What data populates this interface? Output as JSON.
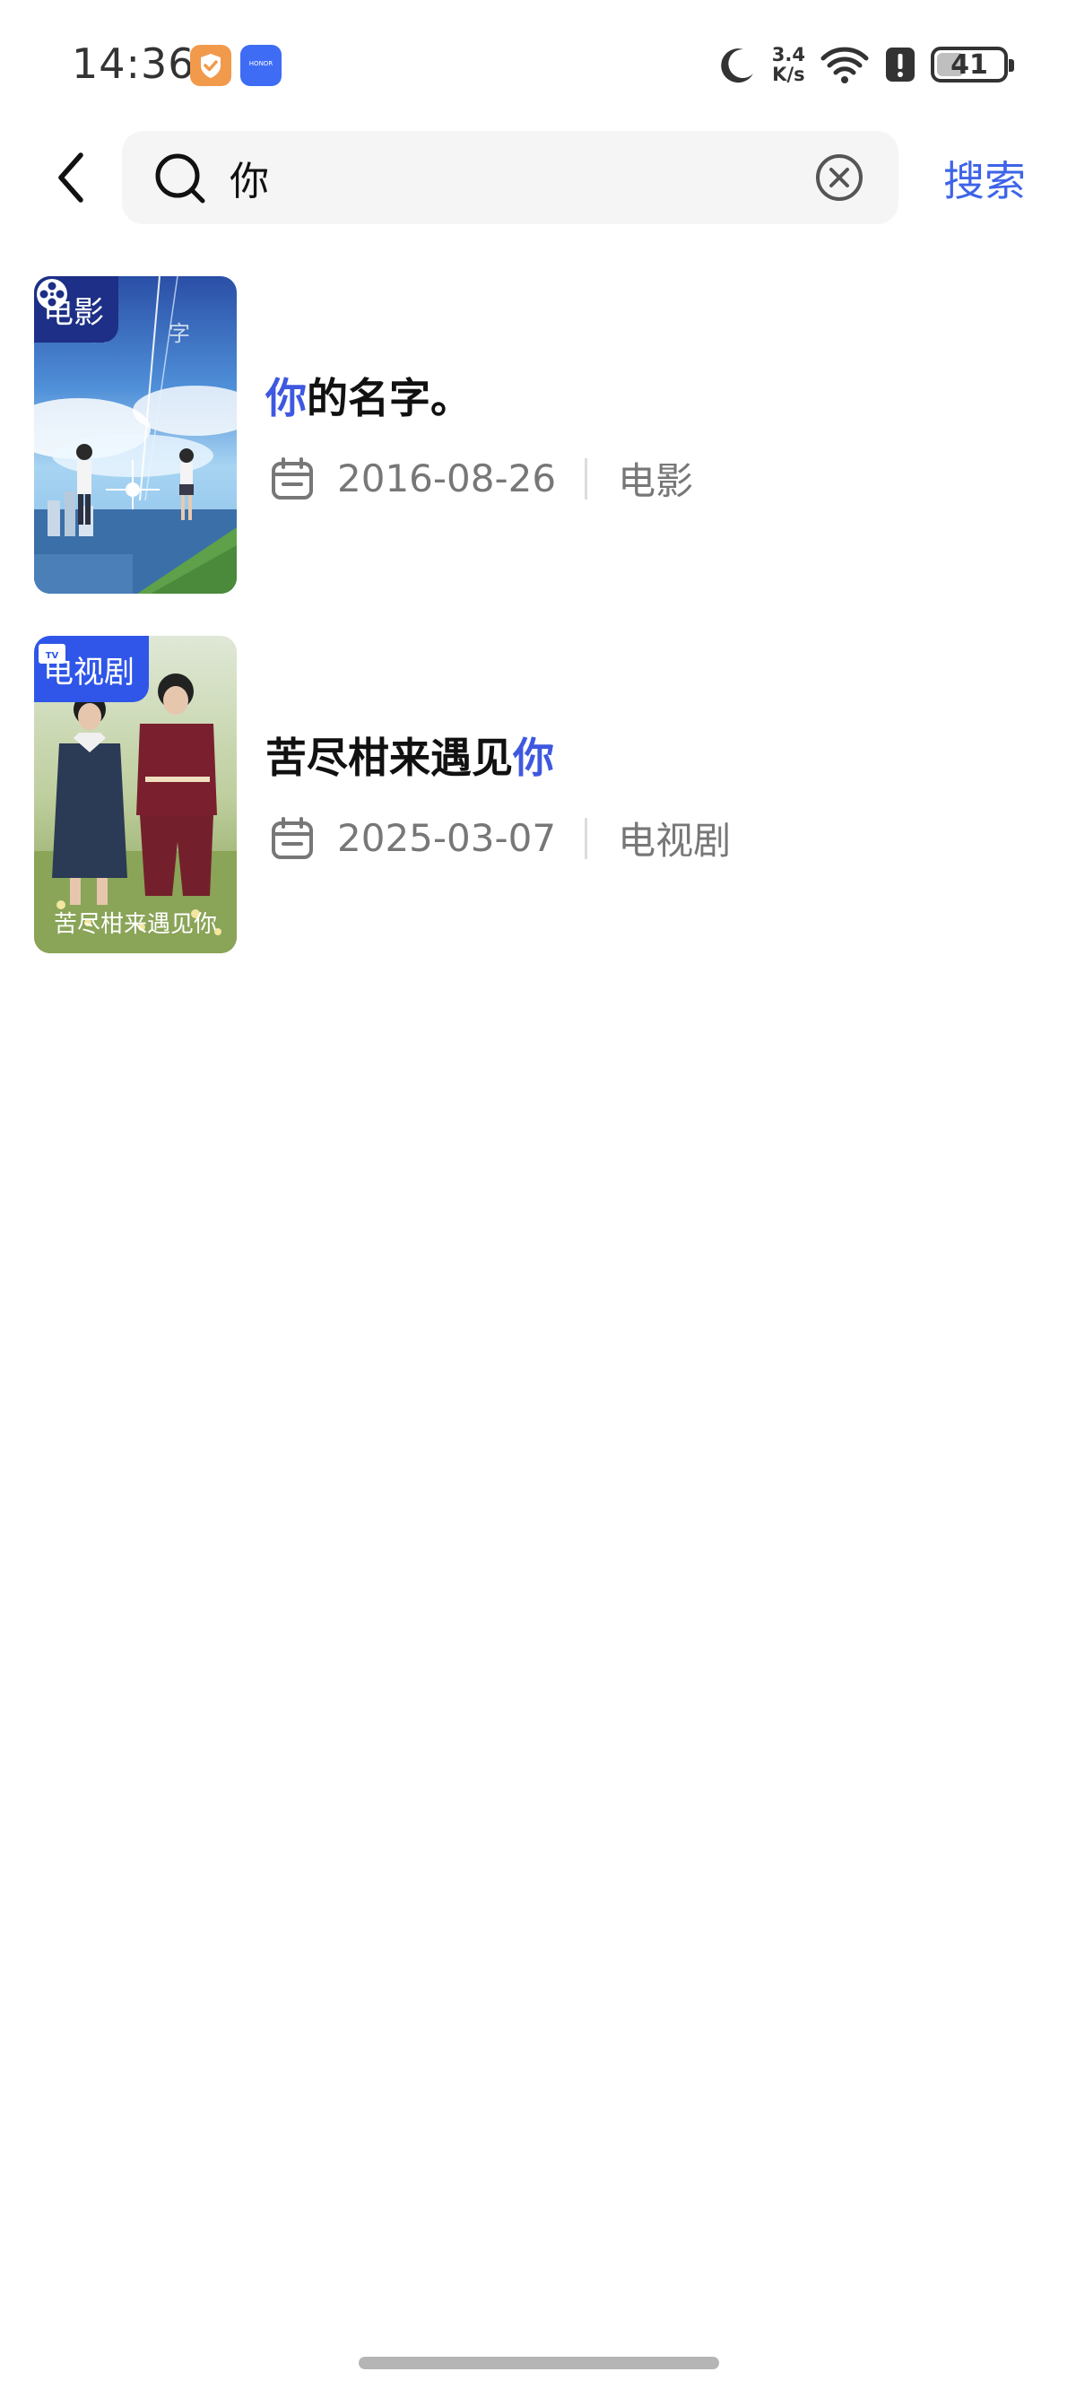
{
  "status_bar": {
    "time": "14:36",
    "app_badges": [
      "security-app-icon",
      "honor-app-icon"
    ],
    "honor_label": "HONOR",
    "icons": [
      "moon-icon",
      "wifi-icon",
      "alert-icon"
    ],
    "net_speed_value": "3.4",
    "net_speed_unit": "K/s",
    "battery": "41",
    "battery_level": 0.41
  },
  "search": {
    "query": "你",
    "placeholder": "",
    "button_label": "搜索",
    "icons": [
      "back-icon",
      "search-icon",
      "clear-icon"
    ]
  },
  "results": [
    {
      "tag": "电影",
      "tag_icon": "film-reel-icon",
      "title_highlight": "你",
      "title_rest": "的名字。",
      "date": "2016-08-26",
      "category": "电影",
      "poster_text": "你的名字",
      "colors": {
        "tag_bg": "#1d2f86"
      }
    },
    {
      "tag": "电视剧",
      "tag_icon": "tv-icon",
      "title_prefix": "苦尽柑来遇见",
      "title_highlight": "你",
      "date": "2025-03-07",
      "category": "电视剧",
      "poster_text": "苦尽柑来遇见你",
      "colors": {
        "tag_bg": "#2f56e8"
      }
    }
  ],
  "colors": {
    "accent": "#3e58e0",
    "search_button": "#3e64e8",
    "meta_text": "#777777"
  }
}
